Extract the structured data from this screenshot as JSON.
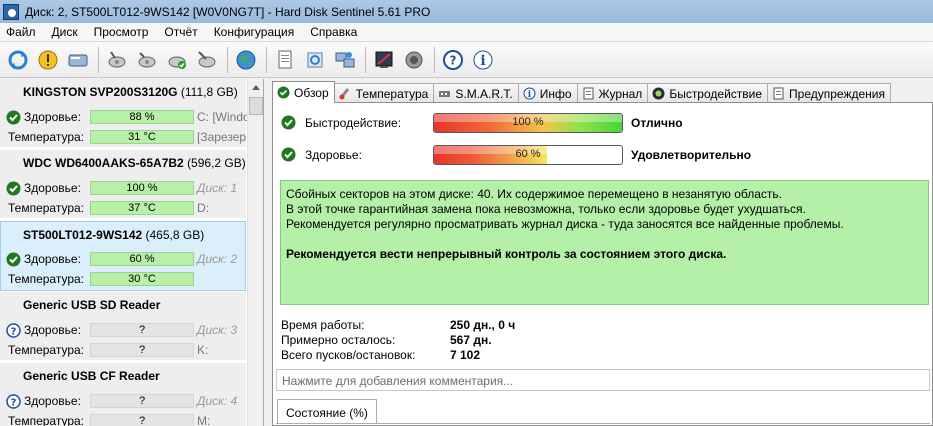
{
  "window": {
    "title": "Диск: 2, ST500LT012-9WS142 [W0V0NG7T]  -  Hard Disk Sentinel 5.61 PRO"
  },
  "menu": [
    "Файл",
    "Диск",
    "Просмотр",
    "Отчёт",
    "Конфигурация",
    "Справка"
  ],
  "toolbar": {
    "icons": [
      "refresh-icon",
      "alert-icon",
      "disk-icon",
      "disk-tools-icon",
      "disk-check-icon",
      "disk-ok-icon",
      "disk-scan-icon",
      "globe-icon",
      "document-icon",
      "settings-icon",
      "network-icon",
      "report-icon",
      "sound-icon",
      "help-icon",
      "info-icon"
    ]
  },
  "disks": [
    {
      "name": "KINGSTON SVP200S3120G",
      "size": "(111,8 GB)",
      "health_label": "Здоровье:",
      "health": "88 %",
      "health_level": 88,
      "health_status": "ok",
      "temp_label": "Температура:",
      "temp": "31 °C",
      "side1": "C: [Windo",
      "side2": "[Зарезер",
      "selected": false
    },
    {
      "name": "WDC WD6400AAKS-65A7B2",
      "size": "(596,2 GB)",
      "health_label": "Здоровье:",
      "health": "100 %",
      "health_level": 100,
      "health_status": "ok",
      "temp_label": "Температура:",
      "temp": "37 °C",
      "side1": "Диск: 1",
      "side2": "D:",
      "selected": false
    },
    {
      "name": "ST500LT012-9WS142",
      "size": "(465,8 GB)",
      "health_label": "Здоровье:",
      "health": "60 %",
      "health_level": 60,
      "health_status": "ok",
      "temp_label": "Температура:",
      "temp": "30 °C",
      "side1": "Диск: 2",
      "side2": "",
      "selected": true
    },
    {
      "name": "Generic USB SD Reader",
      "size": "",
      "health_label": "Здоровье:",
      "health": "?",
      "health_level": 0,
      "health_status": "unknown",
      "temp_label": "Температура:",
      "temp": "?",
      "side1": "Диск: 3",
      "side2": "K:",
      "selected": false
    },
    {
      "name": "Generic USB CF Reader",
      "size": "",
      "health_label": "Здоровье:",
      "health": "?",
      "health_level": 0,
      "health_status": "unknown",
      "temp_label": "Температура:",
      "temp": "?",
      "side1": "Диск: 4",
      "side2": "M:",
      "selected": false
    }
  ],
  "tabs": [
    {
      "label": "Обзор",
      "icon": "check-icon",
      "active": true
    },
    {
      "label": "Температура",
      "icon": "thermometer-icon",
      "active": false
    },
    {
      "label": "S.M.A.R.T.",
      "icon": "smart-icon",
      "active": false
    },
    {
      "label": "Инфо",
      "icon": "info-icon",
      "active": false
    },
    {
      "label": "Журнал",
      "icon": "log-icon",
      "active": false
    },
    {
      "label": "Быстродействие",
      "icon": "speed-icon",
      "active": false
    },
    {
      "label": "Предупреждения",
      "icon": "warnings-icon",
      "active": false
    }
  ],
  "overview": {
    "performance": {
      "label": "Быстродействие:",
      "value": "100 %",
      "level": 100,
      "verdict": "Отлично"
    },
    "health": {
      "label": "Здоровье:",
      "value": "60 %",
      "level": 60,
      "verdict": "Удовлетворительно"
    },
    "notes": [
      "Сбойных секторов на этом диске: 40. Их содержимое перемещено в незанятую область.",
      "В этой точке гарантийная замена пока невозможна, только если здоровье будет ухудшаться.",
      "Рекомендуется регулярно просматривать журнал диска - туда заносятся все найденные проблемы."
    ],
    "recommendation": "Рекомендуется вести непрерывный контроль за состоянием этого диска.",
    "stats": [
      {
        "key": "Время работы:",
        "value": "250 дн., 0 ч"
      },
      {
        "key": "Примерно осталось:",
        "value": "567 дн."
      },
      {
        "key": "Всего пусков/остановок:",
        "value": "7 102"
      }
    ],
    "comment_placeholder": "Нажмите для добавления комментария...",
    "state_tab": "Состояние (%)"
  }
}
